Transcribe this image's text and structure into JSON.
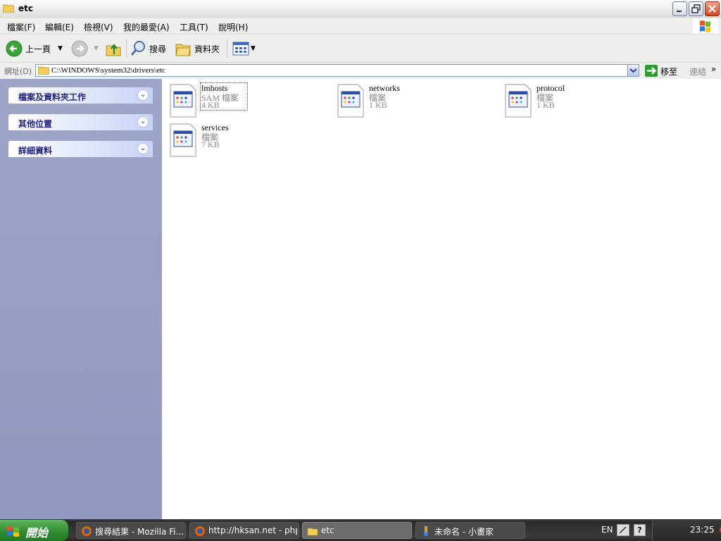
{
  "window": {
    "title": "etc"
  },
  "menu": [
    "檔案(F)",
    "編輯(E)",
    "檢視(V)",
    "我的最愛(A)",
    "工具(T)",
    "說明(H)"
  ],
  "toolbar": {
    "back_label": "上一頁",
    "search_label": "搜尋",
    "folders_label": "資料夾"
  },
  "address": {
    "label": "網址(D)",
    "path": "C:\\WINDOWS\\system32\\drivers\\etc",
    "go_label": "移至",
    "links_label": "連結"
  },
  "tasks": [
    {
      "title": "檔案及資料夾工作"
    },
    {
      "title": "其他位置"
    },
    {
      "title": "詳細資料"
    }
  ],
  "files": [
    {
      "name": "lmhosts",
      "type": "SAM 檔案",
      "size": "4 KB",
      "selected": true
    },
    {
      "name": "networks",
      "type": "檔案",
      "size": "1 KB"
    },
    {
      "name": "protocol",
      "type": "檔案",
      "size": "1 KB"
    },
    {
      "name": "services",
      "type": "檔案",
      "size": "7 KB"
    }
  ],
  "taskbar": {
    "start_label": "開始",
    "buttons": [
      {
        "label": "搜尋結果 - Mozilla Fi..."
      },
      {
        "label": "http://hksan.net - php..."
      },
      {
        "label": "etc",
        "active": true
      },
      {
        "label": "未命名 - 小畫家"
      }
    ],
    "lang": "EN",
    "help": "?",
    "clock": "23:25"
  }
}
